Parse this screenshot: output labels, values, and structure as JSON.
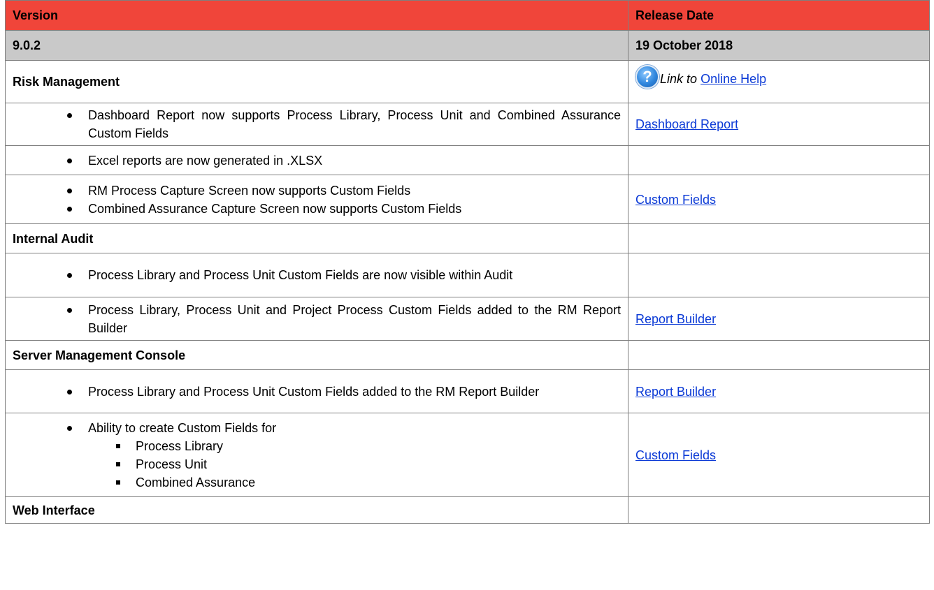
{
  "header": {
    "version": "Version",
    "release_date": "Release Date"
  },
  "release": {
    "version": "9.0.2",
    "date": "19 October 2018"
  },
  "help": {
    "icon": "question-mark-help-icon",
    "prefix": "Link to",
    "link": "Online Help"
  },
  "sections": {
    "risk_management": "Risk Management",
    "internal_audit": "Internal Audit",
    "server_console": "Server Management Console",
    "web_interface": "Web Interface"
  },
  "rows": {
    "rm1": {
      "text": "Dashboard Report now supports Process Library, Process Unit and Combined Assurance Custom Fields",
      "link": "Dashboard Report"
    },
    "rm2": {
      "text": "Excel reports are now generated in .XLSX"
    },
    "rm3": {
      "items": [
        "RM Process Capture Screen now supports Custom Fields",
        "Combined Assurance Capture Screen now supports Custom Fields"
      ],
      "link": "Custom Fields"
    },
    "ia1": {
      "text": "Process Library and Process Unit Custom Fields are now visible within Audit"
    },
    "ia2": {
      "text": "Process Library, Process Unit and Project Process Custom Fields added to the RM Report Builder",
      "link": "Report Builder"
    },
    "smc1": {
      "text": "Process Library and Process Unit Custom Fields added to the RM Report Builder",
      "link": "Report Builder"
    },
    "smc2": {
      "text": "Ability to create Custom Fields for",
      "sub": [
        "Process Library",
        "Process Unit",
        "Combined Assurance"
      ],
      "link": "Custom Fields"
    }
  },
  "colors": {
    "header_bg": "#f0453a",
    "version_bg": "#c9c9c9",
    "link": "#0b3ad6",
    "border": "#7f7f7f"
  }
}
